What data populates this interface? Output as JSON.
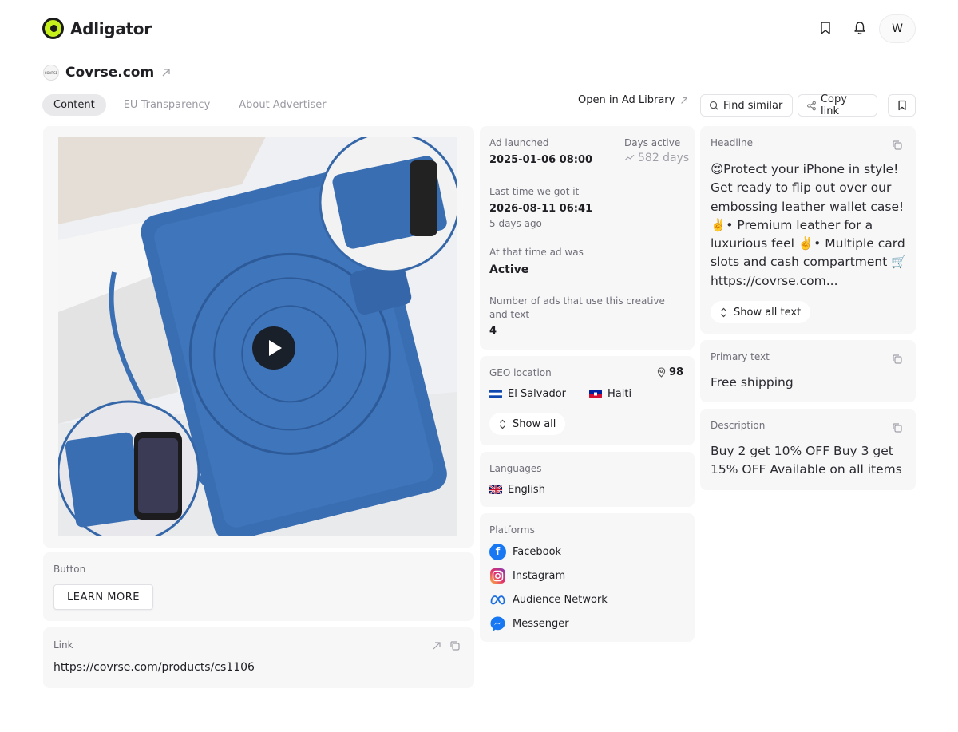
{
  "app": {
    "name": "Adligator",
    "avatar_letter": "W"
  },
  "advertiser": {
    "name": "Covrse.com",
    "logo_text": "COVRSE"
  },
  "tabs": [
    {
      "label": "Content",
      "active": true
    },
    {
      "label": "EU Transparency",
      "active": false
    },
    {
      "label": "About Advertiser",
      "active": false
    }
  ],
  "actions": {
    "open_ad_library": "Open in Ad Library",
    "find_similar": "Find similar",
    "copy_link": "Copy link"
  },
  "media": {
    "type": "video",
    "play_icon": "play-icon"
  },
  "button_card": {
    "label": "Button",
    "cta": "LEARN MORE"
  },
  "link_card": {
    "label": "Link",
    "url": "https://covrse.com/products/cs1106"
  },
  "stats": {
    "ad_launched_label": "Ad launched",
    "ad_launched_value": "2025-01-06 08:00",
    "days_active_label": "Days active",
    "days_active_value": "582 days",
    "last_time_label": "Last time we got it",
    "last_time_value": "2026-08-11 06:41",
    "last_time_ago": "5 days ago",
    "status_label": "At that time ad was",
    "status_value": "Active",
    "num_ads_label": "Number of ads that use this creative and text",
    "num_ads_value": "4"
  },
  "geo": {
    "label": "GEO location",
    "count": "98",
    "locations": [
      "El Salvador",
      "Haiti"
    ],
    "show_all": "Show all"
  },
  "languages": {
    "label": "Languages",
    "items": [
      "English"
    ]
  },
  "platforms": {
    "label": "Platforms",
    "items": [
      "Facebook",
      "Instagram",
      "Audience Network",
      "Messenger"
    ]
  },
  "headline": {
    "label": "Headline",
    "text": "😍Protect your iPhone in style! Get ready to flip out over our embossing leather wallet case! ✌️• Premium leather for a luxurious feel ✌️• Multiple card slots and cash compartment 🛒 https://covrse.com...",
    "show_all": "Show all text"
  },
  "primary_text": {
    "label": "Primary text",
    "text": "Free shipping"
  },
  "description": {
    "label": "Description",
    "text": "Buy 2 get 10% OFF Buy 3 get 15% OFF Available on all items"
  },
  "colors": {
    "accent": "#c6f01c",
    "card_bg": "#f7f7f8",
    "facebook": "#1877f2"
  }
}
